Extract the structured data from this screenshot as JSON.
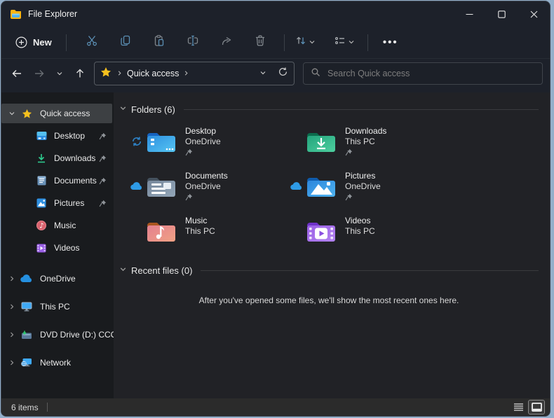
{
  "window": {
    "title": "File Explorer"
  },
  "toolbar": {
    "new_label": "New",
    "icons": [
      "new",
      "cut",
      "copy",
      "paste",
      "rename",
      "share",
      "delete",
      "sort",
      "view",
      "see-more"
    ]
  },
  "navigation": {
    "breadcrumb_root": "Quick access",
    "search_placeholder": "Search Quick access"
  },
  "sidebar": {
    "items": [
      {
        "label": "Quick access",
        "selected": true
      },
      {
        "label": "Desktop",
        "pinned": true
      },
      {
        "label": "Downloads",
        "pinned": true
      },
      {
        "label": "Documents",
        "pinned": true
      },
      {
        "label": "Pictures",
        "pinned": true
      },
      {
        "label": "Music",
        "pinned": false
      },
      {
        "label": "Videos",
        "pinned": false
      },
      {
        "label": "OneDrive"
      },
      {
        "label": "This PC"
      },
      {
        "label": "DVD Drive (D:) CCCC"
      },
      {
        "label": "Network"
      }
    ]
  },
  "main": {
    "folders_section_title": "Folders (6)",
    "tiles": [
      {
        "name": "Desktop",
        "location": "OneDrive",
        "overlay": "sync-icon",
        "pinned": true
      },
      {
        "name": "Downloads",
        "location": "This PC",
        "overlay": "none",
        "pinned": true
      },
      {
        "name": "Documents",
        "location": "OneDrive",
        "overlay": "cloud-icon",
        "pinned": true
      },
      {
        "name": "Pictures",
        "location": "OneDrive",
        "overlay": "cloud-icon",
        "pinned": true
      },
      {
        "name": "Music",
        "location": "This PC",
        "overlay": "none",
        "pinned": false
      },
      {
        "name": "Videos",
        "location": "This PC",
        "overlay": "none",
        "pinned": false
      }
    ],
    "recent_section_title": "Recent files (0)",
    "recent_empty_message": "After you've opened some files, we'll show the most recent ones here."
  },
  "statusbar": {
    "items_count": "6 items"
  },
  "colors": {
    "desktop_background": "#93afca",
    "chrome_background": "#1d212a",
    "sidebar_background": "#191b1e",
    "main_background": "#212226",
    "selection_background": "#3d4043",
    "accent_star": "#f5c01e",
    "accent_blue": "#5b8fb4",
    "folder_desktop": "#3ba2e8",
    "folder_downloads": "#2fae87",
    "folder_documents": "#8399ab",
    "folder_pictures": "#3b95e4",
    "folder_music": "#e98a90",
    "folder_videos": "#a06ae8",
    "cloud_blue": "#2e9be6"
  }
}
